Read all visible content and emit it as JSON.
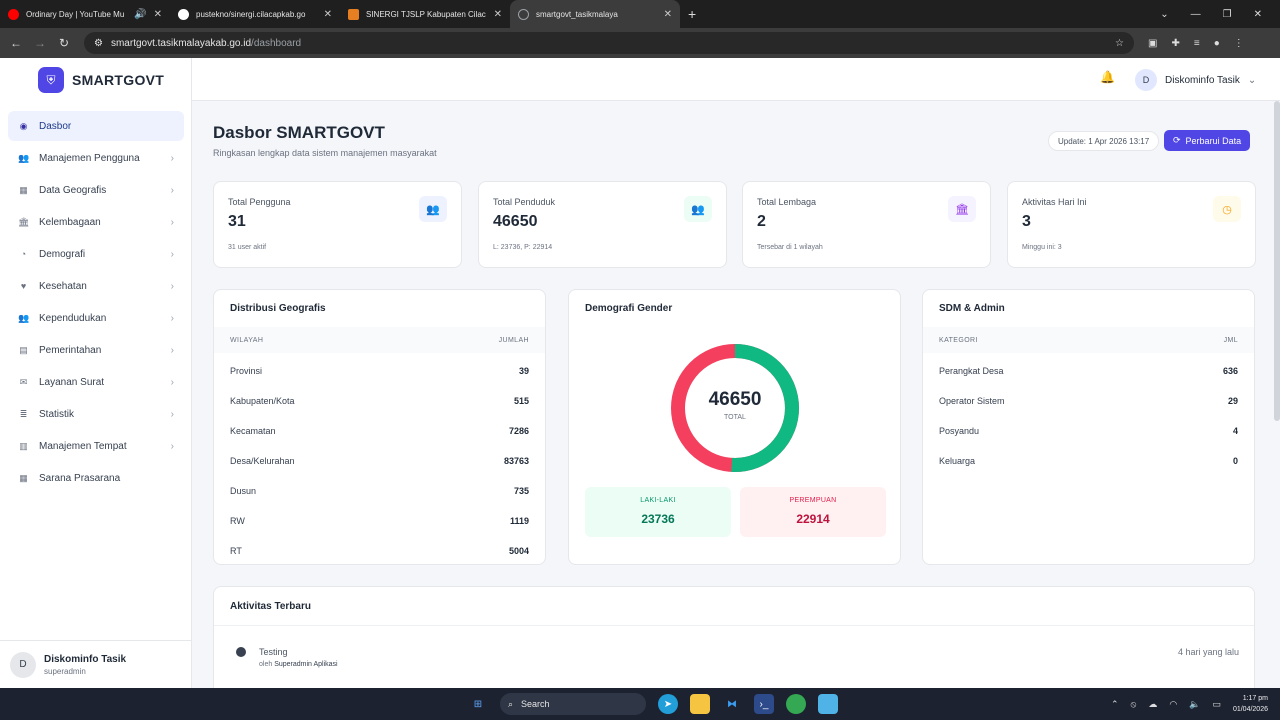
{
  "browser": {
    "tabs": [
      {
        "label": "Ordinary Day | YouTube Mu",
        "icon": "youtube-icon",
        "color": "#ff0000"
      },
      {
        "label": "pustekno/sinergi.cilacapkab.go",
        "icon": "github-icon",
        "color": "#ffffff"
      },
      {
        "label": "SINERGI TJSLP Kabupaten Cilac",
        "icon": "site-icon",
        "color": "#e67e22"
      },
      {
        "label": "smartgovt_tasikmalaya",
        "icon": "globe-icon",
        "color": "#9aa0a6"
      }
    ],
    "url_host": "smartgovt.tasikmalayakab.go.id",
    "url_path": "/dashboard"
  },
  "sidebar": {
    "brand": "SMARTGOVT",
    "items": [
      {
        "label": "Dasbor",
        "icon": "dashboard-icon",
        "active": true,
        "has_children": false
      },
      {
        "label": "Manajemen Pengguna",
        "icon": "users-icon",
        "has_children": true
      },
      {
        "label": "Data Geografis",
        "icon": "map-icon",
        "has_children": true
      },
      {
        "label": "Kelembagaan",
        "icon": "institution-icon",
        "has_children": true
      },
      {
        "label": "Demografi",
        "icon": "pie-chart-icon",
        "has_children": true
      },
      {
        "label": "Kesehatan",
        "icon": "heart-icon",
        "has_children": true
      },
      {
        "label": "Kependudukan",
        "icon": "people-icon",
        "has_children": true
      },
      {
        "label": "Pemerintahan",
        "icon": "building-icon",
        "has_children": true
      },
      {
        "label": "Layanan Surat",
        "icon": "mail-icon",
        "has_children": true
      },
      {
        "label": "Statistik",
        "icon": "stats-icon",
        "has_children": true
      },
      {
        "label": "Manajemen Tempat",
        "icon": "place-icon",
        "has_children": true
      },
      {
        "label": "Sarana Prasarana",
        "icon": "facility-icon",
        "has_children": false
      }
    ],
    "user": {
      "initial": "D",
      "name": "Diskominfo Tasik",
      "role": "superadmin"
    }
  },
  "header": {
    "user_initial": "D",
    "user_name": "Diskominfo Tasik"
  },
  "page": {
    "title": "Dasbor SMARTGOVT",
    "subtitle": "Ringkasan lengkap data sistem manajemen masyarakat",
    "update": "Update: 1 Apr 2026 13:17",
    "refresh_label": "Perbarui Data"
  },
  "stats": [
    {
      "label": "Total Pengguna",
      "value": "31",
      "note": "31 user aktif",
      "icon": "users-icon",
      "color": "#4f46e5",
      "bg": "#eef2ff"
    },
    {
      "label": "Total Penduduk",
      "value": "46650",
      "note": "L: 23736, P: 22914",
      "icon": "people-icon",
      "color": "#10b981",
      "bg": "#ecfdf5"
    },
    {
      "label": "Total Lembaga",
      "value": "2",
      "note": "Tersebar di 1 wilayah",
      "icon": "institution-icon",
      "color": "#9333ea",
      "bg": "#f5f3ff"
    },
    {
      "label": "Aktivitas Hari Ini",
      "value": "3",
      "note": "Minggu ini: 3",
      "icon": "clock-icon",
      "color": "#f59e0b",
      "bg": "#fffbeb"
    }
  ],
  "geo": {
    "title": "Distribusi Geografis",
    "col1": "WILAYAH",
    "col2": "JUMLAH",
    "rows": [
      {
        "k": "Provinsi",
        "v": "39"
      },
      {
        "k": "Kabupaten/Kota",
        "v": "515"
      },
      {
        "k": "Kecamatan",
        "v": "7286"
      },
      {
        "k": "Desa/Kelurahan",
        "v": "83763"
      },
      {
        "k": "Dusun",
        "v": "735"
      },
      {
        "k": "RW",
        "v": "1119"
      },
      {
        "k": "RT",
        "v": "5004"
      }
    ]
  },
  "gender": {
    "title": "Demografi Gender",
    "total": "46650",
    "total_label": "TOTAL",
    "male_label": "LAKI-LAKI",
    "male": 23736,
    "female_label": "PEREMPUAN",
    "female": 22914,
    "male_color": "#10b981",
    "female_color": "#f43f5e"
  },
  "sdm": {
    "title": "SDM & Admin",
    "col1": "KATEGORI",
    "col2": "JML",
    "rows": [
      {
        "k": "Perangkat Desa",
        "v": "636"
      },
      {
        "k": "Operator Sistem",
        "v": "29"
      },
      {
        "k": "Posyandu",
        "v": "4"
      },
      {
        "k": "Keluarga",
        "v": "0"
      }
    ]
  },
  "activity": {
    "title": "Aktivitas Terbaru",
    "items": [
      {
        "name": "Testing",
        "by_prefix": "oleh",
        "by": "Superadmin Aplikasi",
        "time": "4 hari yang lalu"
      }
    ]
  },
  "taskbar": {
    "search_label": "Search",
    "time": "1:17 pm",
    "date": "01/04/2026"
  }
}
